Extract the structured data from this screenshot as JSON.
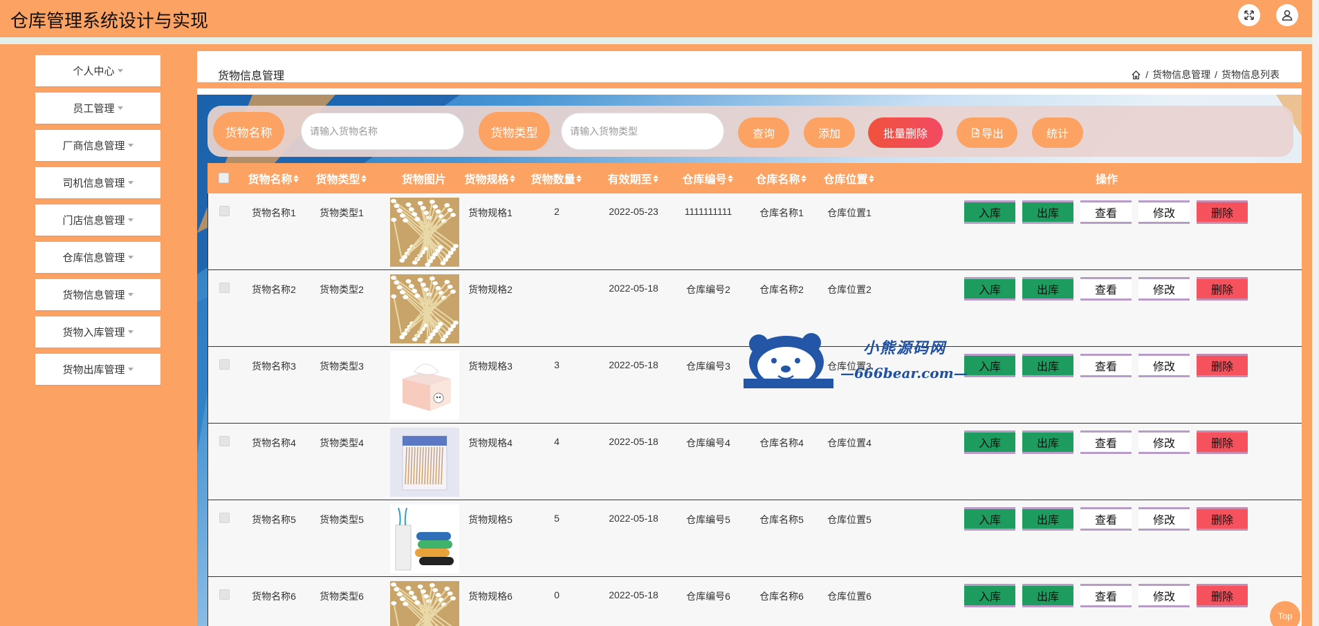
{
  "header": {
    "title": "仓库管理系统设计与实现",
    "fullscreen_icon": "fullscreen-icon",
    "user_icon": "user-icon"
  },
  "sidebar": {
    "items": [
      {
        "label": "个人中心"
      },
      {
        "label": "员工管理"
      },
      {
        "label": "厂商信息管理"
      },
      {
        "label": "司机信息管理"
      },
      {
        "label": "门店信息管理"
      },
      {
        "label": "仓库信息管理"
      },
      {
        "label": "货物信息管理"
      },
      {
        "label": "货物入库管理"
      },
      {
        "label": "货物出库管理"
      }
    ]
  },
  "page": {
    "title": "货物信息管理",
    "breadcrumb": [
      "货物信息管理",
      "货物信息列表"
    ],
    "sep": "/"
  },
  "search": {
    "name_label": "货物名称",
    "name_placeholder": "请输入货物名称",
    "type_label": "货物类型",
    "type_placeholder": "请输入货物类型",
    "query": "查询",
    "add": "添加",
    "batch_delete": "批量删除",
    "export": "导出",
    "stats": "统计"
  },
  "table": {
    "columns": [
      "货物名称",
      "货物类型",
      "货物图片",
      "货物规格",
      "货物数量",
      "有效期至",
      "仓库编号",
      "仓库名称",
      "仓库位置",
      "操作"
    ],
    "actions": {
      "in": "入库",
      "out": "出库",
      "view": "查看",
      "edit": "修改",
      "delete": "删除"
    },
    "rows": [
      {
        "name": "货物名称1",
        "type": "货物类型1",
        "image": "cotton-swabs",
        "spec": "货物规格1",
        "qty": "2",
        "expiry": "2022-05-23",
        "wh_no": "1111111111",
        "wh_name": "仓库名称1",
        "wh_loc": "仓库位置1"
      },
      {
        "name": "货物名称2",
        "type": "货物类型2",
        "image": "cotton-swabs",
        "spec": "货物规格2",
        "qty": "",
        "expiry": "2022-05-18",
        "wh_no": "仓库编号2",
        "wh_name": "仓库名称2",
        "wh_loc": "仓库位置2"
      },
      {
        "name": "货物名称3",
        "type": "货物类型3",
        "image": "tissue-box",
        "spec": "货物规格3",
        "qty": "3",
        "expiry": "2022-05-18",
        "wh_no": "仓库编号3",
        "wh_name": "仓库名称3",
        "wh_loc": "仓库位置3"
      },
      {
        "name": "货物名称4",
        "type": "货物类型4",
        "image": "swab-pack",
        "spec": "货物规格4",
        "qty": "4",
        "expiry": "2022-05-18",
        "wh_no": "仓库编号4",
        "wh_name": "仓库名称4",
        "wh_loc": "仓库位置4"
      },
      {
        "name": "货物名称5",
        "type": "货物类型5",
        "image": "trash-bags",
        "spec": "货物规格5",
        "qty": "5",
        "expiry": "2022-05-18",
        "wh_no": "仓库编号5",
        "wh_name": "仓库名称5",
        "wh_loc": "仓库位置5"
      },
      {
        "name": "货物名称6",
        "type": "货物类型6",
        "image": "cotton-swabs",
        "spec": "货物规格6",
        "qty": "0",
        "expiry": "2022-05-18",
        "wh_no": "仓库编号6",
        "wh_name": "仓库名称6",
        "wh_loc": "仓库位置6"
      }
    ]
  },
  "watermark": {
    "line1": "小熊源码网",
    "line2": "—666bear.com—"
  },
  "top_button": "Top",
  "colors": {
    "accent": "#FCA262",
    "green": "#1E9B5E",
    "red": "#F5525D"
  }
}
